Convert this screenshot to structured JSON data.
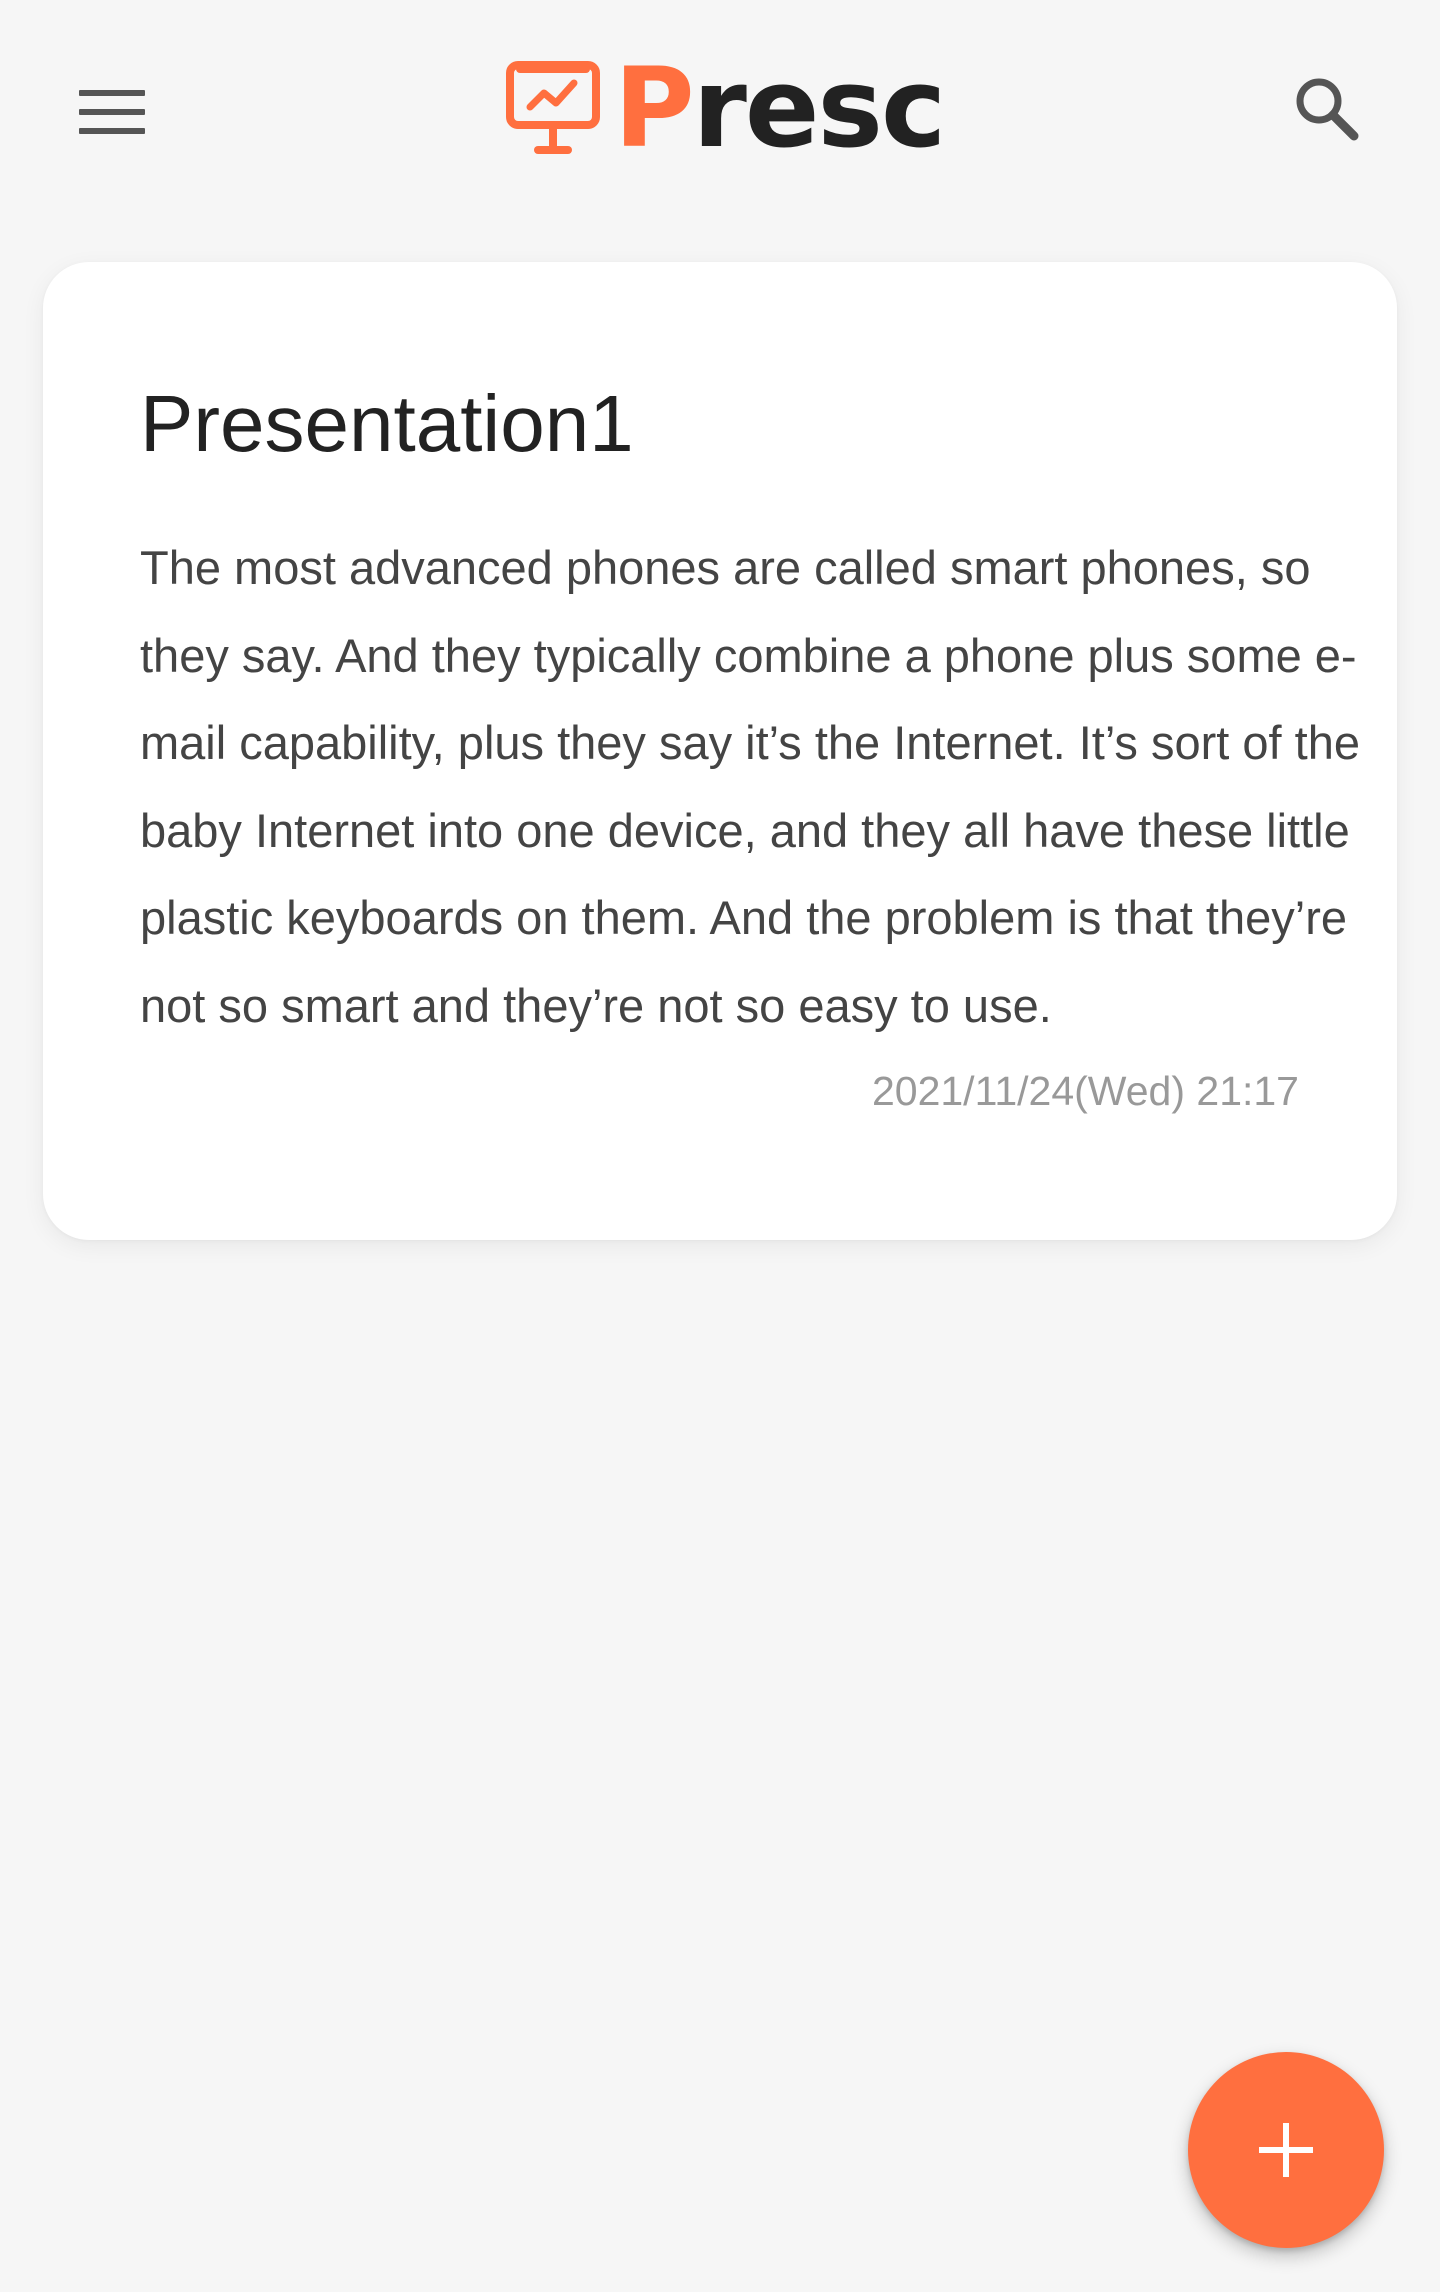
{
  "app": {
    "name": "Presc",
    "name_first_letter": "P",
    "name_rest": "resc",
    "accent_color": "#ff6f3f"
  },
  "appbar": {
    "menu_icon": "hamburger-menu-icon",
    "logo_icon": "presentation-chart-icon",
    "search_icon": "search-icon"
  },
  "presentations": [
    {
      "title": "Presentation1",
      "preview": "The most advanced phones are called smart phones, so they say. And they typically combine a phone plus some e-mail capability, plus they say it’s the Internet. It’s sort of the baby Internet into one device, and they all have these little plastic keyboards on them. And the problem is that they’re not so smart and they’re not so easy to use.",
      "date": "2021/11/24(Wed) 21:17"
    }
  ],
  "fab": {
    "icon": "plus-icon"
  }
}
